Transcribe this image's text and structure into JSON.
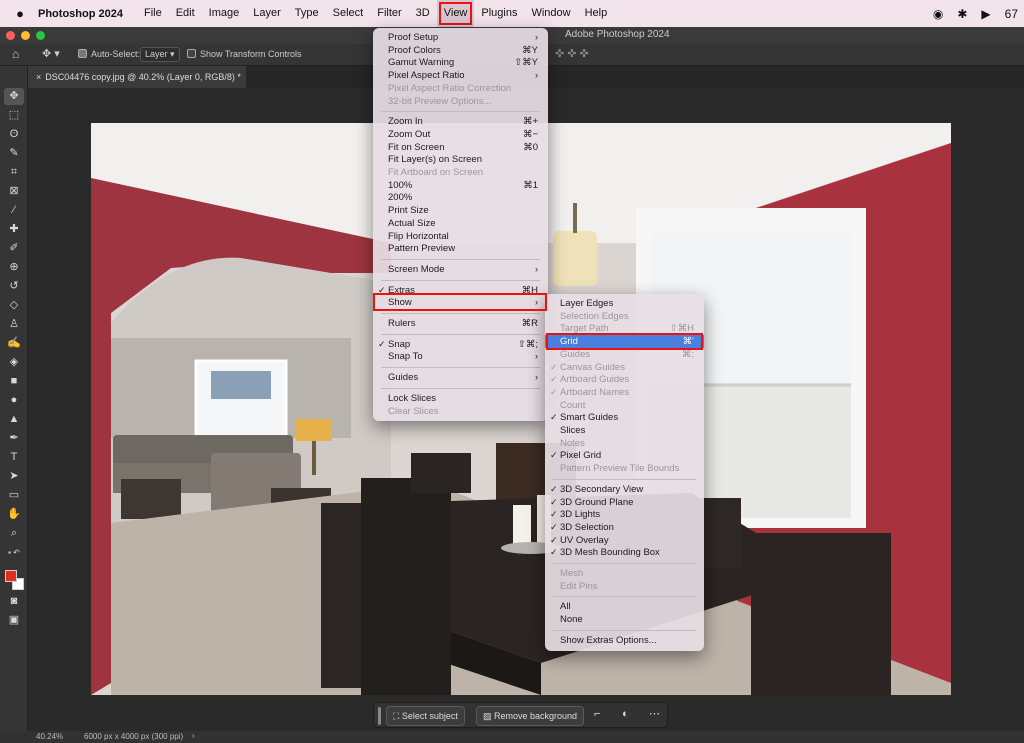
{
  "menubar": {
    "app_name": "Photoshop 2024",
    "items": [
      "File",
      "Edit",
      "Image",
      "Layer",
      "Type",
      "Select",
      "Filter",
      "3D",
      "View",
      "Plugins",
      "Window",
      "Help"
    ],
    "active": "View",
    "battery_text": "67"
  },
  "window": {
    "title": "Adobe Photoshop 2024",
    "traffic_colors": [
      "#fe5f57",
      "#febc2e",
      "#28c840"
    ]
  },
  "options_bar": {
    "auto_select_label": "Auto-Select:",
    "auto_select_value": "Layer",
    "show_transform_label": "Show Transform Controls"
  },
  "document": {
    "tab_label": "DSC04476 copy.jpg @ 40.2% (Layer 0, RGB/8) *"
  },
  "status": {
    "zoom": "40.24%",
    "doc_size": "6000 px x 4000 px (300 ppi)"
  },
  "taskbar": {
    "select_subject": "Select subject",
    "remove_background": "Remove background"
  },
  "view_menu": {
    "items": [
      {
        "label": "Proof Setup",
        "arrow": true
      },
      {
        "label": "Proof Colors",
        "shortcut": "⌘Y"
      },
      {
        "label": "Gamut Warning",
        "shortcut": "⇧⌘Y"
      },
      {
        "label": "Pixel Aspect Ratio",
        "arrow": true
      },
      {
        "label": "Pixel Aspect Ratio Correction",
        "disabled": true
      },
      {
        "label": "32-bit Preview Options...",
        "disabled": true
      },
      {
        "sep": true
      },
      {
        "label": "Zoom In",
        "shortcut": "⌘+"
      },
      {
        "label": "Zoom Out",
        "shortcut": "⌘−"
      },
      {
        "label": "Fit on Screen",
        "shortcut": "⌘0"
      },
      {
        "label": "Fit Layer(s) on Screen"
      },
      {
        "label": "Fit Artboard on Screen",
        "disabled": true
      },
      {
        "label": "100%",
        "shortcut": "⌘1"
      },
      {
        "label": "200%"
      },
      {
        "label": "Print Size"
      },
      {
        "label": "Actual Size"
      },
      {
        "label": "Flip Horizontal"
      },
      {
        "label": "Pattern Preview"
      },
      {
        "sep": true
      },
      {
        "label": "Screen Mode",
        "arrow": true
      },
      {
        "sep": true
      },
      {
        "label": "Extras",
        "shortcut": "⌘H",
        "checked": true
      },
      {
        "label": "Show",
        "arrow": true,
        "highlight": true
      },
      {
        "sep": true
      },
      {
        "label": "Rulers",
        "shortcut": "⌘R"
      },
      {
        "sep": true
      },
      {
        "label": "Snap",
        "shortcut": "⇧⌘;",
        "checked": true
      },
      {
        "label": "Snap To",
        "arrow": true
      },
      {
        "sep": true
      },
      {
        "label": "Guides",
        "arrow": true
      },
      {
        "sep": true
      },
      {
        "label": "Lock Slices"
      },
      {
        "label": "Clear Slices",
        "disabled": true
      }
    ]
  },
  "show_menu": {
    "items": [
      {
        "label": "Layer Edges"
      },
      {
        "label": "Selection Edges",
        "disabled": true
      },
      {
        "label": "Target Path",
        "shortcut": "⇧⌘H",
        "disabled": true
      },
      {
        "label": "Grid",
        "shortcut": "⌘'",
        "highlight": true
      },
      {
        "label": "Guides",
        "shortcut": "⌘;",
        "disabled": true
      },
      {
        "label": "Canvas Guides",
        "checked": true,
        "disabled": true
      },
      {
        "label": "Artboard Guides",
        "checked": true,
        "disabled": true
      },
      {
        "label": "Artboard Names",
        "checked": true,
        "disabled": true
      },
      {
        "label": "Count",
        "disabled": true
      },
      {
        "label": "Smart Guides",
        "checked": true
      },
      {
        "label": "Slices"
      },
      {
        "label": "Notes",
        "disabled": true
      },
      {
        "label": "Pixel Grid",
        "checked": true
      },
      {
        "label": "Pattern Preview Tile Bounds",
        "disabled": true
      },
      {
        "sep": true
      },
      {
        "label": "3D Secondary View",
        "checked": true
      },
      {
        "label": "3D Ground Plane",
        "checked": true
      },
      {
        "label": "3D Lights",
        "checked": true
      },
      {
        "label": "3D Selection",
        "checked": true
      },
      {
        "label": "UV Overlay",
        "checked": true
      },
      {
        "label": "3D Mesh Bounding Box",
        "checked": true
      },
      {
        "sep": true
      },
      {
        "label": "Mesh",
        "disabled": true
      },
      {
        "label": "Edit Pins",
        "disabled": true
      },
      {
        "sep": true
      },
      {
        "label": "All"
      },
      {
        "label": "None"
      },
      {
        "sep": true
      },
      {
        "label": "Show Extras Options..."
      }
    ]
  },
  "icons": {
    "move": "move-icon",
    "marquee": "marquee-icon",
    "lasso": "lasso-icon",
    "wand": "magic-wand-icon",
    "crop": "crop-icon",
    "frame": "frame-icon",
    "eyedropper": "eyedropper-icon",
    "healing": "healing-brush-icon",
    "brush": "brush-icon",
    "stamp": "clone-stamp-icon",
    "history": "history-brush-icon",
    "eraser": "eraser-icon",
    "gradient": "gradient-icon",
    "blur": "blur-icon",
    "dodge": "dodge-icon",
    "pen": "pen-icon",
    "type": "type-icon",
    "path_select": "path-selection-icon",
    "shape": "shape-icon",
    "hand": "hand-icon",
    "zoom": "zoom-icon"
  }
}
